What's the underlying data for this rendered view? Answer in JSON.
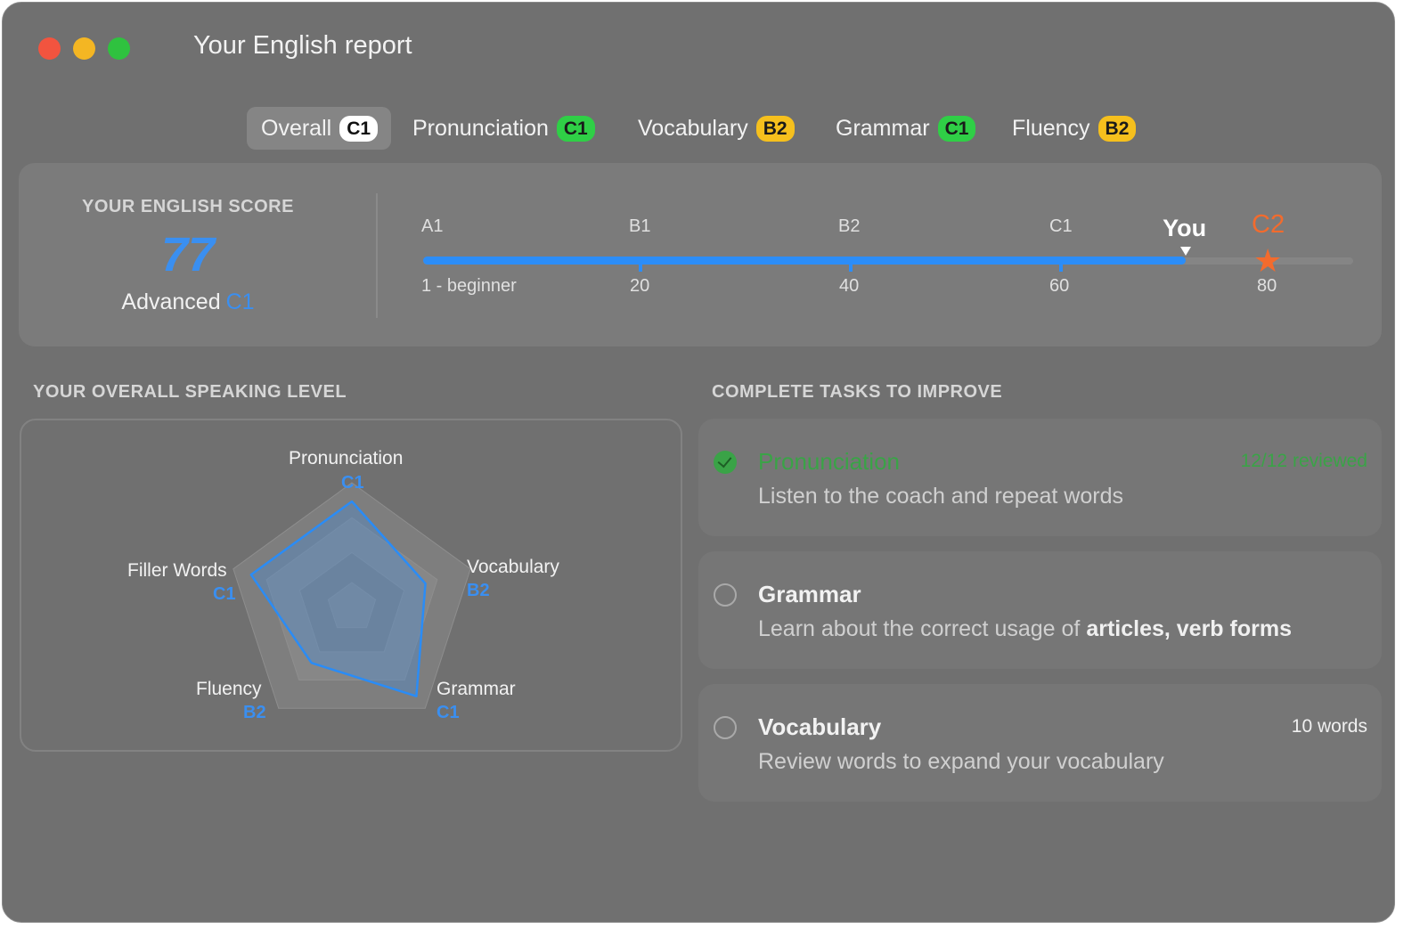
{
  "window": {
    "title": "Your English report"
  },
  "tabs": [
    {
      "label": "Overall",
      "level": "C1",
      "active": true,
      "badge_color": "#ffffff"
    },
    {
      "label": "Pronunciation",
      "level": "C1",
      "active": false,
      "badge_color": "#2fcf46"
    },
    {
      "label": "Vocabulary",
      "level": "B2",
      "active": false,
      "badge_color": "#f6c01d"
    },
    {
      "label": "Grammar",
      "level": "C1",
      "active": false,
      "badge_color": "#2fcf46"
    },
    {
      "label": "Fluency",
      "level": "B2",
      "active": false,
      "badge_color": "#f6c01d"
    }
  ],
  "score": {
    "label": "YOUR ENGLISH SCORE",
    "value": "77",
    "level_text": "Advanced",
    "level_code": "C1",
    "you_label": "You",
    "goal_label": "C2",
    "scale_levels": [
      "A1",
      "B1",
      "B2",
      "C1"
    ],
    "scale_numbers": [
      "1 - beginner",
      "20",
      "40",
      "60",
      "80"
    ],
    "progress_fraction": 0.82
  },
  "speaking_level": {
    "title": "YOUR OVERALL SPEAKING LEVEL",
    "axes": [
      {
        "name": "Pronunciation",
        "level": "C1",
        "value": 0.85
      },
      {
        "name": "Vocabulary",
        "level": "B2",
        "value": 0.62
      },
      {
        "name": "Grammar",
        "level": "C1",
        "value": 0.88
      },
      {
        "name": "Fluency",
        "level": "B2",
        "value": 0.55
      },
      {
        "name": "Filler Words",
        "level": "C1",
        "value": 0.85
      }
    ],
    "line_color": "#2a8cf6"
  },
  "tasks": {
    "title": "COMPLETE TASKS TO IMPROVE",
    "items": [
      {
        "title": "Pronunciation",
        "desc": "Listen to the coach and repeat words",
        "meta": "12/12 reviewed",
        "done": true
      },
      {
        "title": "Grammar",
        "desc_prefix": "Learn about the correct usage of ",
        "desc_bold": "articles, verb forms",
        "meta": "",
        "done": false
      },
      {
        "title": "Vocabulary",
        "desc": "Review words to expand your vocabulary",
        "meta": "10 words",
        "done": false
      }
    ]
  }
}
